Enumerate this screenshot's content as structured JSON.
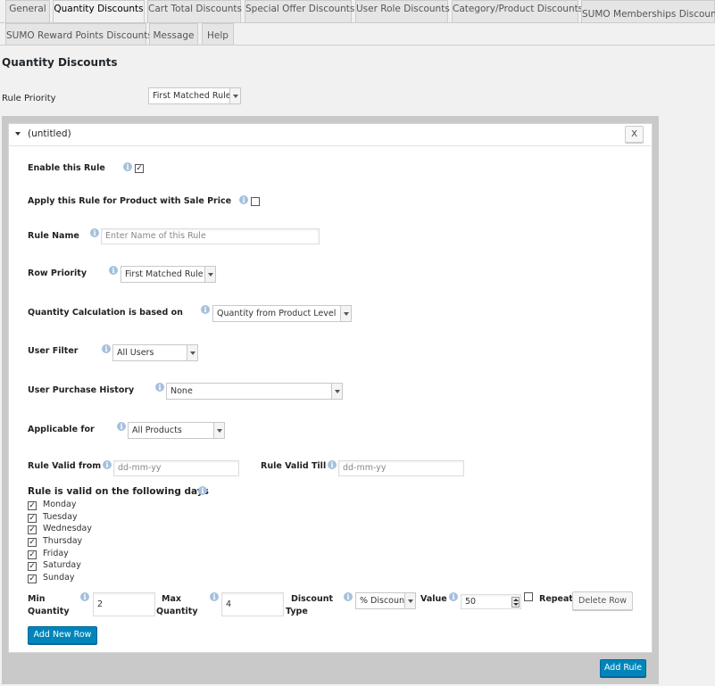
{
  "tabs": {
    "row1": [
      "General",
      "Quantity Discounts",
      "Cart Total Discounts",
      "Special Offer Discounts",
      "User Role Discounts",
      "Category/Product Discounts",
      "SUMO Memberships Discounts"
    ],
    "row2": [
      "SUMO Reward Points Discounts",
      "Message",
      "Help"
    ],
    "active": "Quantity Discounts"
  },
  "page": {
    "title": "Quantity Discounts",
    "rule_priority_label": "Rule Priority",
    "rule_priority_value": "First Matched Rule"
  },
  "rule": {
    "title": "(untitled)",
    "close_label": "X",
    "toggle_icon": "caret-down-icon",
    "enable_label": "Enable this Rule",
    "enable_checked": true,
    "sale_price_label": "Apply this Rule for Product with Sale Price",
    "sale_price_checked": false,
    "rule_name_label": "Rule Name",
    "rule_name_placeholder": "Enter Name of this Rule",
    "row_priority_label": "Row Priority",
    "row_priority_value": "First Matched Rule",
    "qty_calc_label": "Quantity Calculation is based on",
    "qty_calc_value": "Quantity from Product Level",
    "user_filter_label": "User Filter",
    "user_filter_value": "All Users",
    "purchase_history_label": "User Purchase History",
    "purchase_history_value": "None",
    "applicable_label": "Applicable for",
    "applicable_value": "All Products",
    "valid_from_label": "Rule Valid from",
    "valid_from_placeholder": "dd-mm-yy",
    "valid_till_label": "Rule Valid Till",
    "valid_till_placeholder": "dd-mm-yy",
    "days_label": "Rule is valid on the following days",
    "days": [
      {
        "name": "Monday",
        "checked": true
      },
      {
        "name": "Tuesday",
        "checked": true
      },
      {
        "name": "Wednesday",
        "checked": true
      },
      {
        "name": "Thursday",
        "checked": true
      },
      {
        "name": "Friday",
        "checked": true
      },
      {
        "name": "Saturday",
        "checked": true
      },
      {
        "name": "Sunday",
        "checked": true
      }
    ],
    "row": {
      "min_qty_label_1": "Min",
      "min_qty_label_2": "Quantity",
      "min_qty_value": "2",
      "max_qty_label_1": "Max",
      "max_qty_label_2": "Quantity",
      "max_qty_value": "4",
      "discount_type_label_1": "Discount",
      "discount_type_label_2": "Type",
      "discount_type_value": "% Discount",
      "value_label": "Value",
      "value_value": "50",
      "repeat_label": "Repeat",
      "repeat_checked": false,
      "delete_row_label": "Delete Row"
    },
    "add_new_row_label": "Add New Row"
  },
  "add_rule_label": "Add Rule",
  "colors": {
    "primary": "#0085ba",
    "panel_bg": "#c9c9c9",
    "info_icon": "#a5c0dd"
  }
}
